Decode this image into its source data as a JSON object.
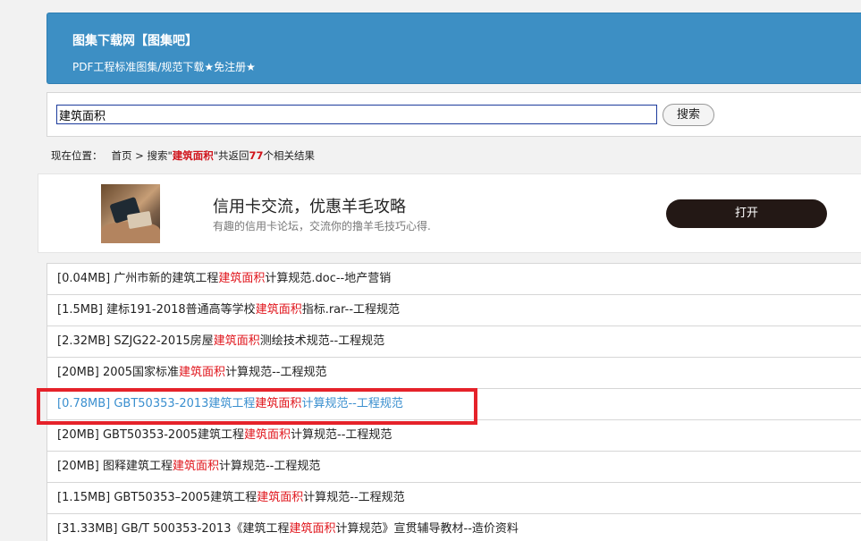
{
  "header": {
    "title": "图集下载网【图集吧】",
    "subtitle": "PDF工程标准图集/规范下载★免注册★"
  },
  "search": {
    "value": "建筑面积",
    "button_label": "搜索"
  },
  "breadcrumb": {
    "label": "现在位置：",
    "home": "首页",
    "separator": ">",
    "search_prefix": "搜索\"",
    "keyword": "建筑面积",
    "search_suffix": "\"共返回",
    "count": "77",
    "results_suffix": "个相关结果"
  },
  "ad": {
    "image": "credit-card-photo",
    "title": "信用卡交流，优惠羊毛攻略",
    "description": "有趣的信用卡论坛，交流你的撸羊毛技巧心得.",
    "button_label": "打开"
  },
  "results": [
    {
      "before": "[0.04MB] 广州市新的建筑工程",
      "keyword": "建筑面积",
      "after": "计算规范.doc--地产营销"
    },
    {
      "before": "[1.5MB] 建标191-2018普通高等学校",
      "keyword": "建筑面积",
      "after": "指标.rar--工程规范"
    },
    {
      "before": "[2.32MB] SZJG22-2015房屋",
      "keyword": "建筑面积",
      "after": "测绘技术规范--工程规范"
    },
    {
      "before": "[20MB] 2005国家标准",
      "keyword": "建筑面积",
      "after": "计算规范--工程规范"
    },
    {
      "before": "[0.78MB] GBT50353-2013建筑工程",
      "keyword": "建筑面积",
      "after": "计算规范--工程规范"
    },
    {
      "before": "[20MB] GBT50353-2005建筑工程",
      "keyword": "建筑面积",
      "after": "计算规范--工程规范"
    },
    {
      "before": "[20MB] 图释建筑工程",
      "keyword": "建筑面积",
      "after": "计算规范--工程规范"
    },
    {
      "before": "[1.15MB] GBT50353–2005建筑工程",
      "keyword": "建筑面积",
      "after": "计算规范--工程规范"
    },
    {
      "before": "[31.33MB] GB/T 500353-2013《建筑工程",
      "keyword": "建筑面积",
      "after": "计算规范》宣贯辅导教材--造价资料"
    }
  ],
  "colors": {
    "header_bg": "#3d8fc4",
    "keyword_red": "#e0141b",
    "hover_link": "#3a8fcf",
    "annotation_red": "#e5222a",
    "ad_button": "#231815"
  }
}
